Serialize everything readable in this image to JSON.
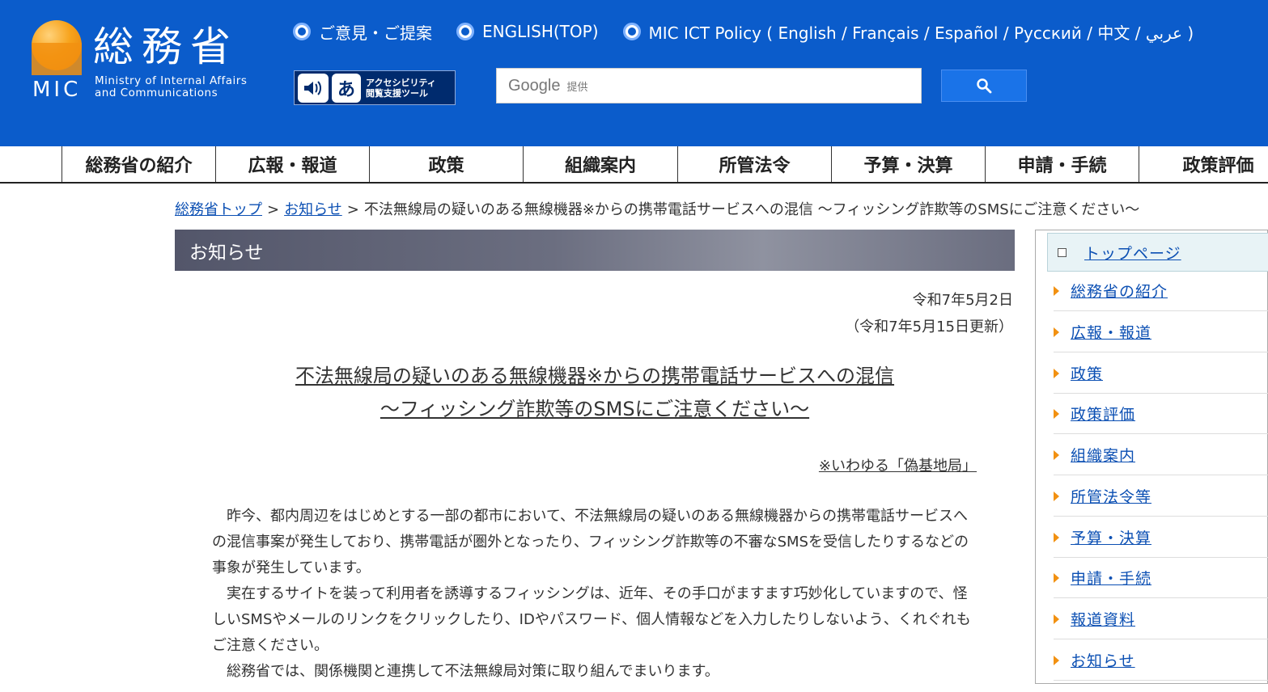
{
  "header": {
    "logo_kanji": "総務省",
    "logo_mic": "MIC",
    "logo_en_line1": "Ministry of Internal Affairs",
    "logo_en_line2": "and Communications",
    "top_links": [
      {
        "label": "ご意見・ご提案"
      },
      {
        "label": "ENGLISH(TOP)"
      },
      {
        "label": "MIC ICT Policy ( English / Français / Español / Русский / 中文 / عربي )"
      }
    ],
    "accessibility_line1": "アクセシビリティ",
    "accessibility_line2": "閲覧支援ツール",
    "accessibility_char": "あ",
    "search_brand": "Google",
    "search_sub": "提供"
  },
  "nav": [
    {
      "label": "総務省の紹介"
    },
    {
      "label": "広報・報道"
    },
    {
      "label": "政策"
    },
    {
      "label": "組織案内"
    },
    {
      "label": "所管法令"
    },
    {
      "label": "予算・決算"
    },
    {
      "label": "申請・手続"
    },
    {
      "label": "政策評価"
    }
  ],
  "breadcrumb": {
    "home": "総務省トップ",
    "sep": ">",
    "news": "お知らせ",
    "current": "不法無線局の疑いのある無線機器※からの携帯電話サービスへの混信 ～フィッシング詐欺等のSMSにご注意ください～"
  },
  "main": {
    "section_title": "お知らせ",
    "date": "令和7年5月2日",
    "updated": "（令和7年5月15日更新）",
    "title_line1": "不法無線局の疑いのある無線機器※からの携帯電話サービスへの混信",
    "title_line2": "～フィッシング詐欺等のSMSにご注意ください～",
    "note": "※いわゆる「偽基地局」",
    "paragraphs": [
      "昨今、都内周辺をはじめとする一部の都市において、不法無線局の疑いのある無線機器からの携帯電話サービスへの混信事案が発生しており、携帯電話が圏外となったり、フィッシング詐欺等の不審なSMSを受信したりするなどの事象が発生しています。",
      "実在するサイトを装って利用者を誘導するフィッシングは、近年、その手口がますます巧妙化していますので、怪しいSMSやメールのリンクをクリックしたり、IDやパスワード、個人情報などを入力したりしないよう、くれぐれもご注意ください。",
      "総務省では、関係機関と連携して不法無線局対策に取り組んでまいります。"
    ]
  },
  "sidebar": {
    "top": "トップページ",
    "items": [
      {
        "label": "総務省の紹介"
      },
      {
        "label": "広報・報道"
      },
      {
        "label": "政策"
      },
      {
        "label": "政策評価"
      },
      {
        "label": "組織案内"
      },
      {
        "label": "所管法令等"
      },
      {
        "label": "予算・決算"
      },
      {
        "label": "申請・手続"
      },
      {
        "label": "報道資料"
      },
      {
        "label": "お知らせ"
      }
    ]
  },
  "colors": {
    "header_bg": "#0b5ccb",
    "brand_orange": "#f29111",
    "link_blue": "#0b4fb3"
  },
  "icons": [
    "radio-icon",
    "speaker-icon",
    "search-icon",
    "square-icon",
    "arrow-right-icon"
  ]
}
